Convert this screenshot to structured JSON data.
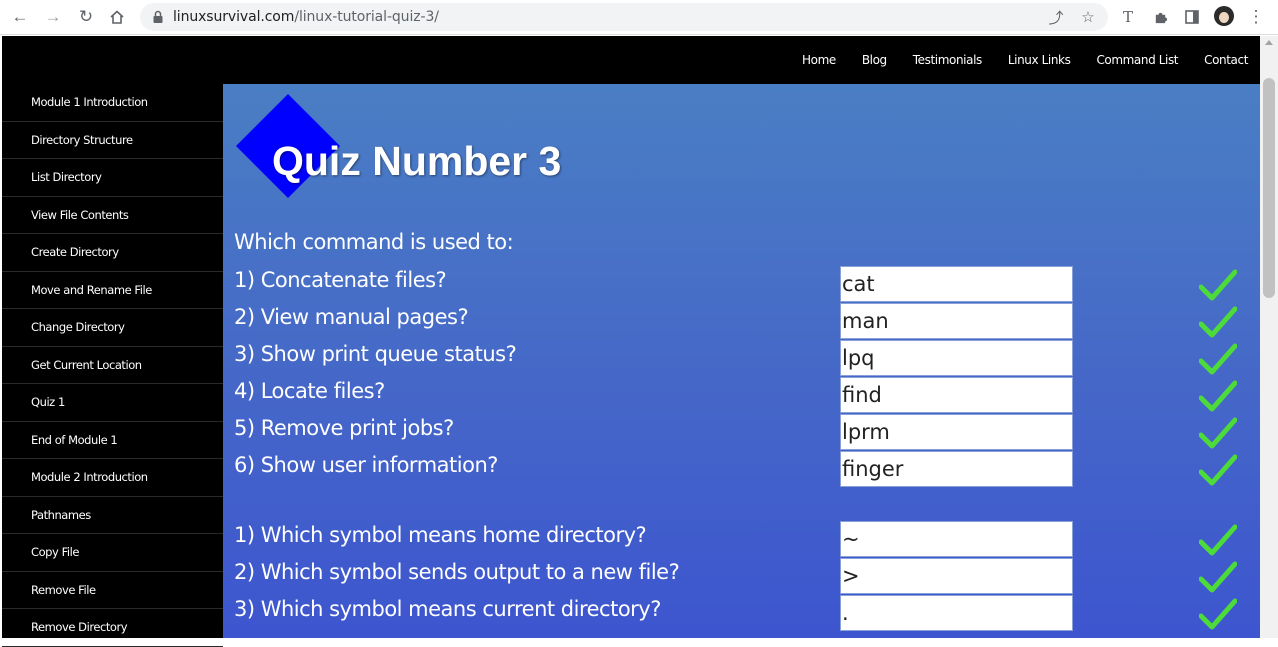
{
  "browser": {
    "url_domain": "linuxsurvival.com",
    "url_path": "/linux-tutorial-quiz-3/"
  },
  "top_nav": [
    "Home",
    "Blog",
    "Testimonials",
    "Linux Links",
    "Command List",
    "Contact"
  ],
  "sidebar": [
    "Module 1 Introduction",
    "Directory Structure",
    "List Directory",
    "View File Contents",
    "Create Directory",
    "Move and Rename File",
    "Change Directory",
    "Get Current Location",
    "Quiz 1",
    "End of Module 1",
    "Module 2 Introduction",
    "Pathnames",
    "Copy File",
    "Remove File",
    "Remove Directory"
  ],
  "quiz": {
    "title": "Quiz Number 3",
    "intro": "Which command is used to:",
    "command_questions": [
      {
        "label": "1) Concatenate files?",
        "answer": "cat"
      },
      {
        "label": "2) View manual pages?",
        "answer": "man"
      },
      {
        "label": "3) Show print queue status?",
        "answer": "lpq"
      },
      {
        "label": "4) Locate files?",
        "answer": "find"
      },
      {
        "label": "5) Remove print jobs?",
        "answer": "lprm"
      },
      {
        "label": "6) Show user information?",
        "answer": "finger"
      }
    ],
    "symbol_questions": [
      {
        "label": "1) Which symbol means home directory?",
        "answer": "~"
      },
      {
        "label": "2) Which symbol sends output to a new file?",
        "answer": ">"
      },
      {
        "label": "3) Which symbol means current directory?",
        "answer": "."
      }
    ]
  },
  "colors": {
    "logo_diamond": "#0000ff",
    "checkmark": "#4ddb3a",
    "header_bg": "#000000"
  }
}
